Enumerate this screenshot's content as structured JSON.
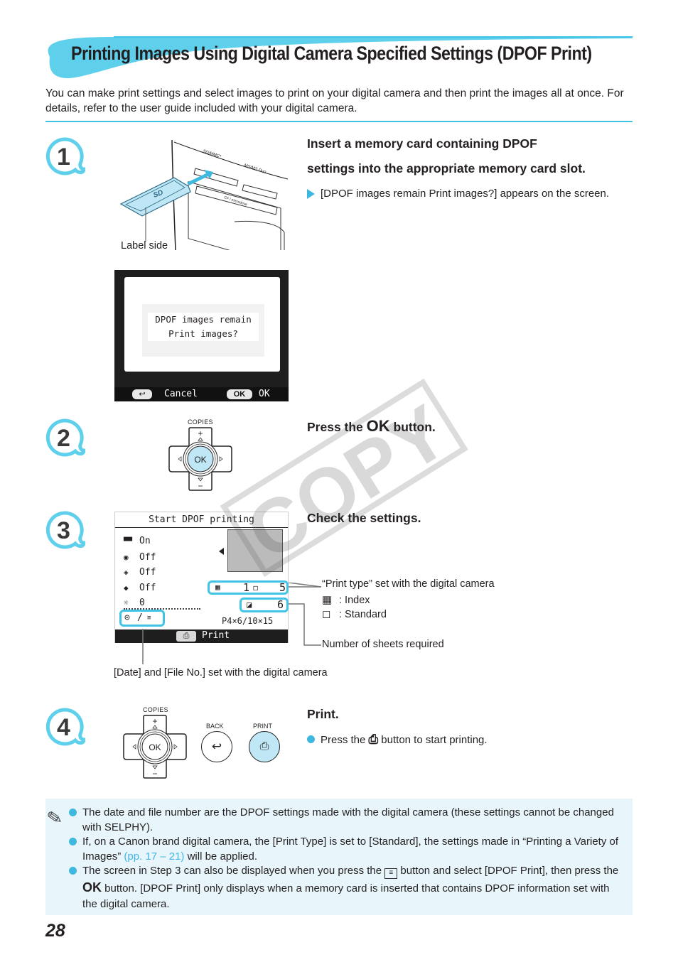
{
  "header": {
    "title": "Printing Images Using Digital Camera Specified Settings (DPOF Print)",
    "intro": "You can make print settings and select images to print on your digital camera and then print the images all at once. For details, refer to the user guide included with your digital camera."
  },
  "colors": {
    "accent": "#41c3e5",
    "swoosh": "#5fd0ec",
    "note_bg": "#e8f6fb",
    "link": "#41b6e6",
    "text": "#231f20"
  },
  "steps": [
    {
      "number": "1",
      "heading_line1": "Insert a memory card containing DPOF",
      "heading_line2": "settings into the appropriate memory card slot.",
      "result": "[DPOF images remain Print images?] appears on the screen.",
      "illustration": {
        "label_side": "Label side",
        "slot_labels": [
          "SD/MMC*",
          "MS/MS Duo",
          "CF / microdrive"
        ],
        "card_logo": "SD"
      },
      "screen": {
        "line1": "DPOF images remain",
        "line2": "Print images?",
        "cancel_label": "Cancel",
        "ok_key": "OK",
        "ok_label": "OK"
      }
    },
    {
      "number": "2",
      "heading_pre": "Press the ",
      "heading_ok": "OK",
      "heading_post": " button.",
      "dpad": {
        "top_label": "COPIES",
        "center": "OK",
        "plus": "+",
        "minus": "−"
      }
    },
    {
      "number": "3",
      "heading": "Check the settings.",
      "screen": {
        "title": "Start DPOF printing",
        "settings": [
          {
            "icon": "image-optimize-icon",
            "value": "On"
          },
          {
            "icon": "red-eye-icon",
            "value": "Off"
          },
          {
            "icon": "face-brightness-icon",
            "value": "Off"
          },
          {
            "icon": "face-correction-icon",
            "value": "Off"
          },
          {
            "icon": "brightness-icon",
            "value": "0"
          }
        ],
        "index_count": "1",
        "standard_count": "5",
        "sheets": "6",
        "paper_size": "P4×6/10×15",
        "date_file": "/",
        "print_label": "Print"
      },
      "callouts": {
        "print_type": "“Print type” set with the digital camera",
        "index": ": Index",
        "standard": ": Standard",
        "sheets": "Number of sheets required",
        "date_file": "[Date] and [File No.] set with the digital camera"
      }
    },
    {
      "number": "4",
      "heading": "Print.",
      "bullet_pre": "Press the ",
      "bullet_post": " button to start printing.",
      "buttons": {
        "copies": "COPIES",
        "ok": "OK",
        "back": "BACK",
        "print": "PRINT"
      }
    }
  ],
  "notes": [
    {
      "text": "The date and file number are the DPOF settings made with the digital camera (these settings cannot be changed with SELPHY)."
    },
    {
      "pre": "If, on a Canon brand digital camera, the [Print Type] is set to [Standard], the settings made in “Printing a Variety of Images” ",
      "link": "(pp. 17 – 21)",
      "post": " will be applied."
    },
    {
      "pre": "The screen in Step 3 can also be displayed when you press the ",
      "mid": " button and select [DPOF Print], then press the ",
      "ok": "OK",
      "post": " button. [DPOF Print] only displays when a memory card is inserted that contains DPOF information set with the digital camera."
    }
  ],
  "watermark": "COPY",
  "page_number": "28"
}
